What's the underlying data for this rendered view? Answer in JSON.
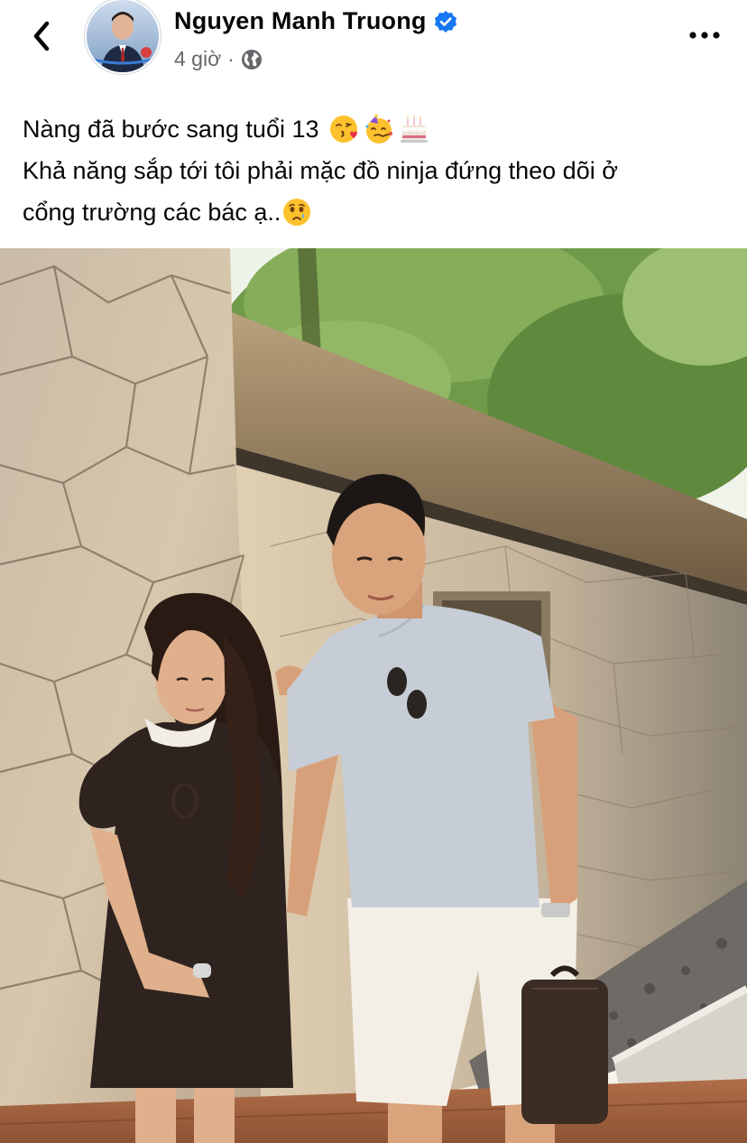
{
  "post": {
    "author": {
      "name": "Nguyen Manh Truong",
      "verified": true
    },
    "meta": {
      "time": "4 giờ",
      "separator": "·",
      "audience_icon": "globe-icon"
    },
    "caption": {
      "line1": "Nàng đã bước sang tuổi 13",
      "line1_emojis": [
        "kissing-face-with-heart-emoji",
        "partying-face-emoji",
        "birthday-cake-emoji"
      ],
      "line2": "Khả năng sắp tới tôi phải mặc đồ ninja đứng theo dõi ở",
      "line3": "cổng trường các bác ạ..",
      "line3_emojis": [
        "face-holding-back-tears-emoji"
      ]
    },
    "photo": {
      "description_icon": "post-photo"
    }
  },
  "icons": {
    "back": "chevron-left-icon",
    "more": "more-horizontal-icon",
    "verified": "verified-badge-icon"
  },
  "colors": {
    "verified_blue": "#1877f2",
    "meta_gray": "#65676b",
    "text": "#050505"
  }
}
